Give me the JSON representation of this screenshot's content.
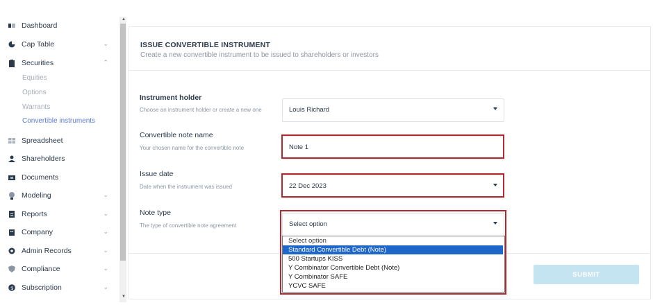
{
  "sidebar": {
    "items": [
      {
        "label": "Dashboard"
      },
      {
        "label": "Cap Table"
      },
      {
        "label": "Securities"
      },
      {
        "label": "Spreadsheet"
      },
      {
        "label": "Shareholders"
      },
      {
        "label": "Documents"
      },
      {
        "label": "Modeling"
      },
      {
        "label": "Reports"
      },
      {
        "label": "Company"
      },
      {
        "label": "Admin Records"
      },
      {
        "label": "Compliance"
      },
      {
        "label": "Subscription"
      }
    ],
    "sub_items": [
      {
        "label": "Equities"
      },
      {
        "label": "Options"
      },
      {
        "label": "Warrants"
      },
      {
        "label": "Convertible instruments"
      }
    ]
  },
  "form": {
    "title": "ISSUE CONVERTIBLE INSTRUMENT",
    "subtitle": "Create a new convertible instrument to be issued to shareholders or investors",
    "holder_label": "Instrument holder",
    "holder_help": "Choose an instrument holder or create a new one",
    "holder_value": "Louis Richard",
    "name_label": "Convertible note name",
    "name_help": "Your chosen name for the convertible note",
    "name_value": "Note 1",
    "date_label": "Issue date",
    "date_help": "Date when the instrument was issued",
    "date_value": "22 Dec 2023",
    "type_label": "Note type",
    "type_help": "The type of convertible note agreement",
    "type_value": "Select option",
    "submit_label": "SUBMIT"
  },
  "dropdown": {
    "options": [
      "Select option",
      "Standard Convertible Debt (Note)",
      "500 Startups KISS",
      "Y Combinator Convertible Debt (Note)",
      "Y Combinator SAFE",
      "YCVC SAFE"
    ],
    "highlighted_index": 1
  },
  "colors": {
    "highlight_border": "#b3282d",
    "selected_option": "#1e66c8",
    "submit_bg": "#c5e4f1"
  }
}
